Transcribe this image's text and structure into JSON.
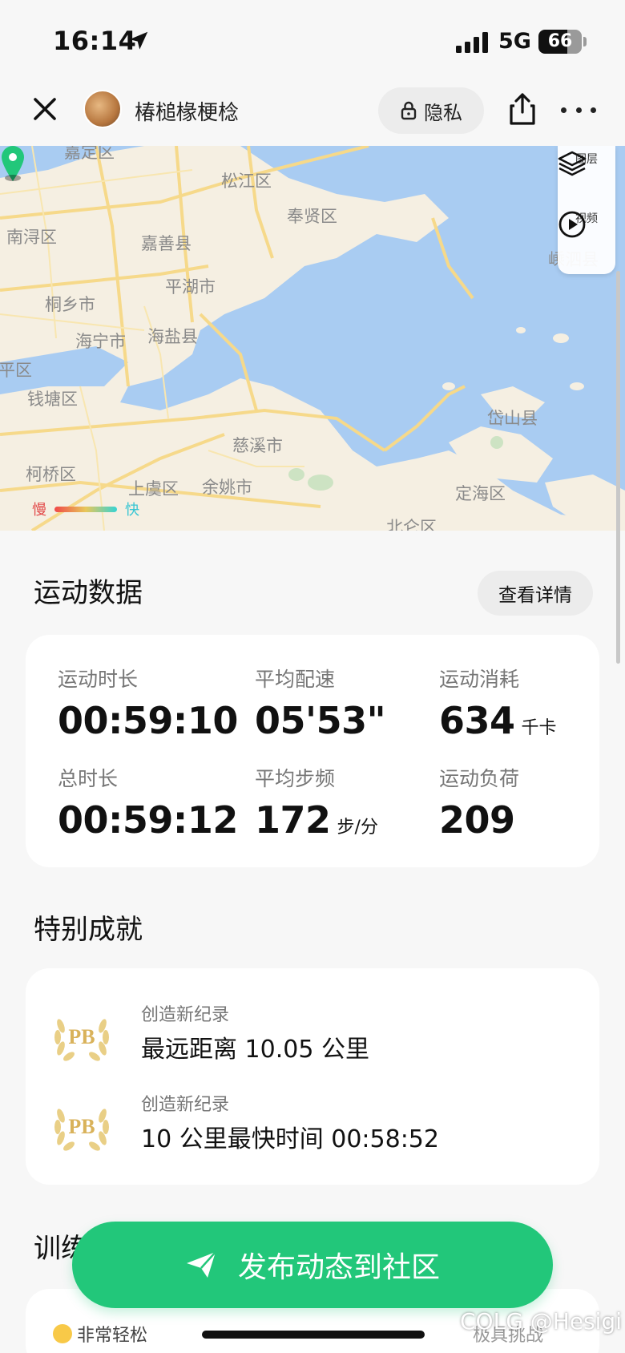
{
  "status_bar": {
    "time": "16:14",
    "network": "5G",
    "battery": "66",
    "battery_level_percent": 66,
    "icons": [
      "location-arrow-icon",
      "signal-icon",
      "battery-icon"
    ]
  },
  "nav": {
    "username": "椿槌椽梗棯",
    "privacy_label": "隐私",
    "icons": [
      "close-icon",
      "lock-icon",
      "share-icon",
      "more-icon"
    ]
  },
  "map": {
    "labels": {
      "songjiang": "松江区",
      "fengxian": "奉贤区",
      "nanxun": "南浔区",
      "jiashan": "嘉善县",
      "pinghu": "平湖市",
      "tongxiang": "桐乡市",
      "haining": "海宁市",
      "haiyan": "海盐县",
      "qiantang": "钱塘区",
      "cixi": "慈溪市",
      "keqiao": "柯桥区",
      "shangyu": "上虞区",
      "yuyao": "余姚市",
      "daishan": "岱山县",
      "dinghai": "定海区",
      "beilun": "北仑区",
      "jiading": "嘉定区",
      "pingqu": "平区",
      "shengsi": "嵊泗县"
    },
    "layers_label": "图层",
    "video_label": "视频",
    "speed_slow": "慢",
    "speed_fast": "快",
    "colors": {
      "water": "#a9ccf2",
      "land": "#f5efe2",
      "road": "#f6d98a",
      "pin": "#22c77a"
    }
  },
  "sport_data": {
    "title": "运动数据",
    "details_button": "查看详情",
    "stats": [
      {
        "label": "运动时长",
        "value": "00:59:10",
        "unit": ""
      },
      {
        "label": "平均配速",
        "value": "05'53\"",
        "unit": ""
      },
      {
        "label": "运动消耗",
        "value": "634",
        "unit": "千卡"
      },
      {
        "label": "总时长",
        "value": "00:59:12",
        "unit": ""
      },
      {
        "label": "平均步频",
        "value": "172",
        "unit": "步/分"
      },
      {
        "label": "运动负荷",
        "value": "209",
        "unit": ""
      }
    ]
  },
  "achievements": {
    "title": "特别成就",
    "items": [
      {
        "subtitle": "创造新纪录",
        "title": "最远距离 10.05 公里",
        "badge": "PB"
      },
      {
        "subtitle": "创造新纪录",
        "title": "10 公里最快时间 00:58:52",
        "badge": "PB"
      }
    ]
  },
  "training": {
    "title_partial": "训练",
    "effort_left": "非常轻松",
    "effort_right": "极具挑战"
  },
  "cta": {
    "label": "发布动态到社区",
    "icon": "send-icon",
    "color": "#22c77a"
  },
  "watermark": "COLG @Hesigi"
}
